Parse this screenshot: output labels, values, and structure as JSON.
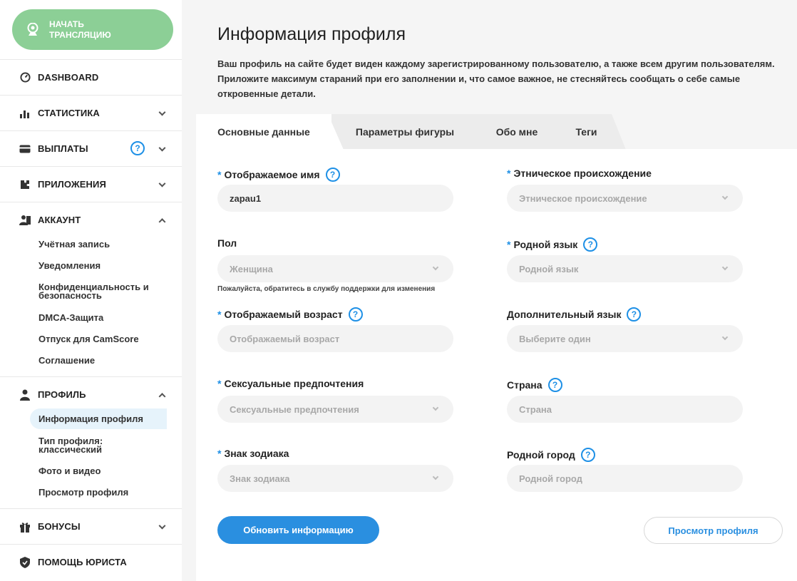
{
  "sidebar": {
    "start_button": "НАЧАТЬ ТРАНСЛЯЦИЮ",
    "nav": [
      {
        "label": "DASHBOARD"
      },
      {
        "label": "СТАТИСТИКА"
      },
      {
        "label": "ВЫПЛАТЫ"
      },
      {
        "label": "ПРИЛОЖЕНИЯ"
      },
      {
        "label": "АККАУНТ"
      },
      {
        "label": "ПРОФИЛЬ"
      },
      {
        "label": "БОНУСЫ"
      },
      {
        "label": "ПОМОЩЬ ЮРИСТА"
      }
    ],
    "account_sub": [
      "Учётная запись",
      "Уведомления",
      "Конфиденциальность и безопасность",
      "DMCA-Защита",
      "Отпуск для CamScore",
      "Соглашение"
    ],
    "profile_sub": [
      "Информация профиля",
      "Тип профиля: классический",
      "Фото и видео",
      "Просмотр профиля"
    ],
    "help_glyph": "?"
  },
  "main": {
    "title": "Информация профиля",
    "description": "Ваш профиль на сайте будет виден каждому зарегистрированному пользователю, а также всем другим пользователям. Приложите максимум стараний при его заполнении и, что самое важное, не стесняйтесь сообщать о себе самые откровенные детали.",
    "tabs": [
      "Основные данные",
      "Параметры фигуры",
      "Обо мне",
      "Теги"
    ],
    "form": {
      "display_name": {
        "label": "Отображаемое имя",
        "value": "zapau1"
      },
      "ethnicity": {
        "label": "Этническое происхождение",
        "placeholder": "Этническое происхождение"
      },
      "gender": {
        "label": "Пол",
        "value": "Женщина",
        "hint": "Пожалуйста, обратитесь в службу поддержки для изменения"
      },
      "native_language": {
        "label": "Родной язык",
        "placeholder": "Родной язык"
      },
      "display_age": {
        "label": "Отображаемый возраст",
        "placeholder": "Отображаемый возраст"
      },
      "additional_language": {
        "label": "Дополнительный язык",
        "placeholder": "Выберите один"
      },
      "sexual_pref": {
        "label": "Сексуальные предпочтения",
        "placeholder": "Сексуальные предпочтения"
      },
      "country": {
        "label": "Страна",
        "placeholder": "Страна"
      },
      "zodiac": {
        "label": "Знак зодиака",
        "placeholder": "Знак зодиака"
      },
      "hometown": {
        "label": "Родной город",
        "placeholder": "Родной город"
      },
      "required_mark": "*"
    },
    "update_button": "Обновить информацию",
    "preview_button": "Просмотр профиля"
  },
  "colors": {
    "accent": "#2a8fe0",
    "start_button": "#8ccf96",
    "required": "#1e90e6"
  }
}
